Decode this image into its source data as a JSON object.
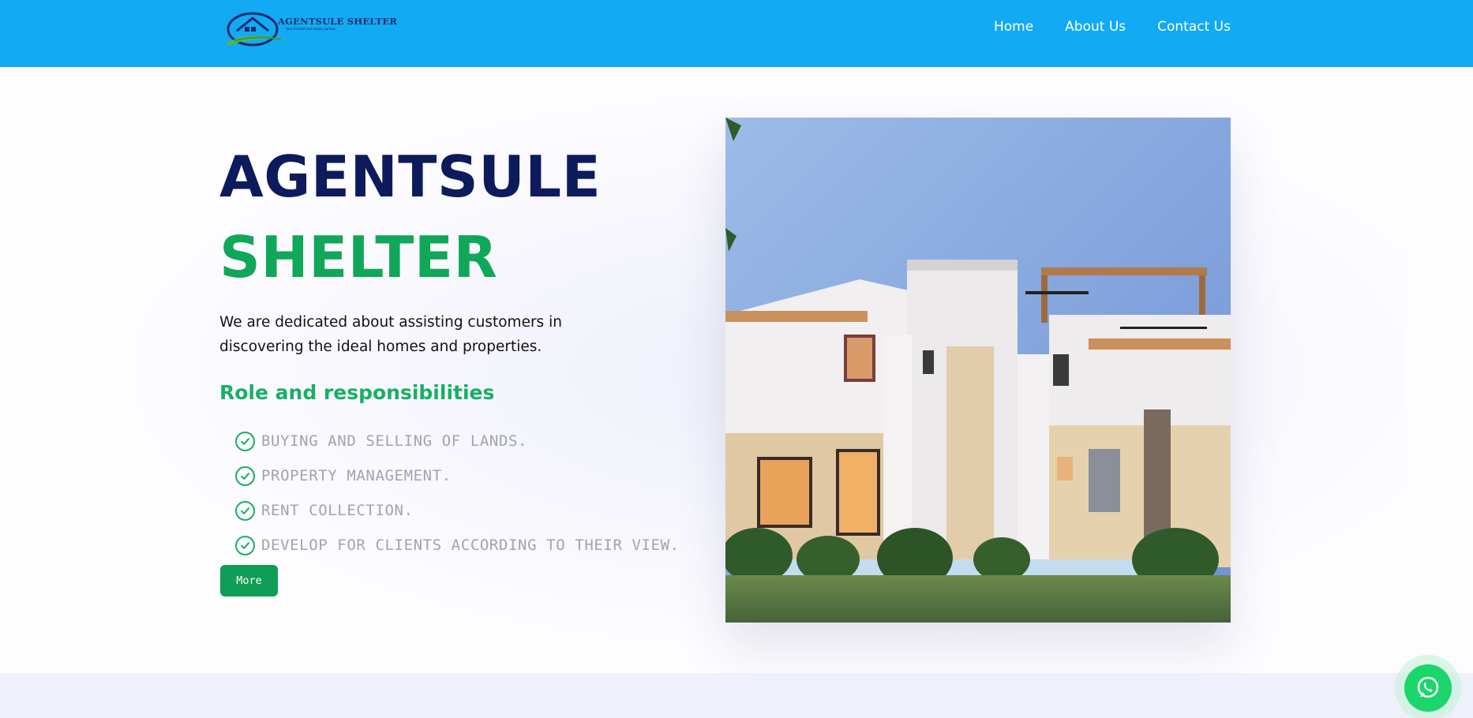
{
  "header": {
    "logo": {
      "name": "AGENTSULE SHELTER",
      "tagline": "Your trusted real estate partner"
    },
    "nav": [
      {
        "label": "Home"
      },
      {
        "label": "About Us"
      },
      {
        "label": "Contact Us"
      }
    ]
  },
  "hero": {
    "title_line1": "AGENTSULE",
    "title_line2": "SHELTER",
    "description": "We are dedicated about assisting customers in discovering the ideal homes and properties.",
    "roles_heading": "Role and responsibilities",
    "roles": [
      "BUYING AND SELLING OF LANDS.",
      "PROPERTY MANAGEMENT.",
      "RENT COLLECTION.",
      "DEVELOP FOR CLIENTS ACCORDING TO THEIR VIEW."
    ],
    "more_button": "More"
  },
  "colors": {
    "header_bg": "#12aaf2",
    "title_navy": "#0d1a5c",
    "accent_green": "#10a75a",
    "whatsapp_green": "#1bd66b"
  },
  "icons": [
    "check-circle-icon",
    "whatsapp-icon",
    "house-logo-icon"
  ]
}
